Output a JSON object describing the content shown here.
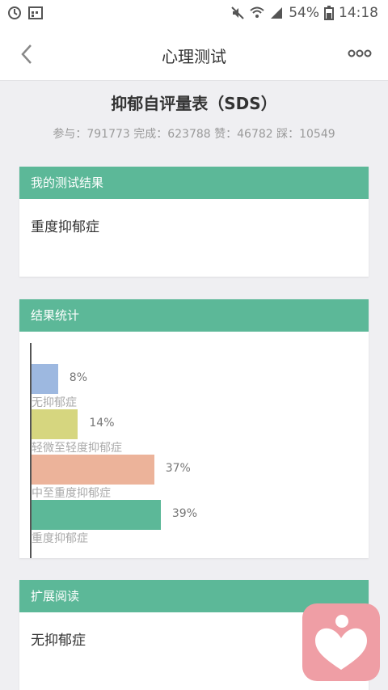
{
  "status_bar": {
    "battery": "54%",
    "time": "14:18"
  },
  "nav": {
    "title": "心理测试"
  },
  "test": {
    "title": "抑郁自评量表（SDS）",
    "stats": "参与：791773 完成：623788 赞：46782 踩：10549"
  },
  "result_card": {
    "header": "我的测试结果",
    "body": "重度抑郁症"
  },
  "stats_card": {
    "header": "结果统计"
  },
  "chart_data": {
    "type": "bar",
    "orientation": "horizontal",
    "categories": [
      "无抑郁症",
      "轻微至轻度抑郁症",
      "中至重度抑郁症",
      "重度抑郁症"
    ],
    "values": [
      8,
      14,
      37,
      39
    ],
    "value_labels": [
      "8%",
      "14%",
      "37%",
      "39%"
    ],
    "colors": [
      "#9db8e0",
      "#d6d67f",
      "#ecb39a",
      "#5cb898"
    ],
    "xlim": [
      0,
      100
    ]
  },
  "extended_card": {
    "header": "扩展阅读",
    "body": "无抑郁症"
  },
  "colors": {
    "accent": "#5cb898",
    "fab": "#ef9ea5"
  }
}
